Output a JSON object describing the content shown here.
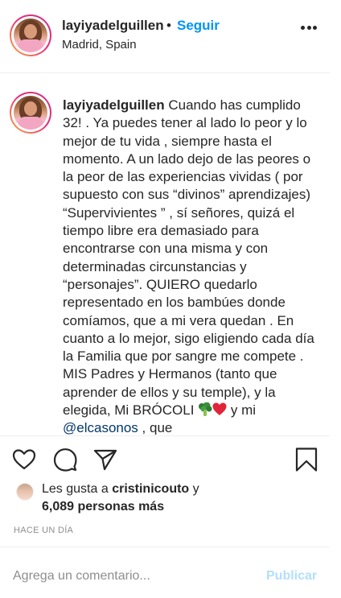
{
  "post_header": {
    "username": "layiyadelguillen",
    "separator": "•",
    "follow_label": "Seguir",
    "location": "Madrid, Spain",
    "more_icon": "more-horizontal-icon"
  },
  "caption": {
    "username": "layiyadelguillen",
    "text_before_mention": "Cuando has cumplido 32! . Ya puedes tener al lado lo peor y lo mejor de tu vida , siempre hasta el momento. A un lado dejo de las peores o la peor de las experiencias vividas ( por supuesto con sus “divinos” aprendizajes) “Supervivientes ” , sí señores, quizá el tiempo libre era demasiado para encontrarse con una misma y con determinadas circunstancias y “personajes”. QUIERO quedarlo representado en los bambúes donde comíamos, que a mi vera quedan . En cuanto a lo mejor, sigo eligiendo cada día la Familia que por sangre me compete . MIS Padres y Hermanos (tanto que aprender de ellos y su temple), y la elegida, Mi BRÓCOLI",
    "text_middle": "y mi",
    "mention": "@elcasonos",
    "text_after_mention": ", que",
    "emojis": [
      "broccoli-emoji",
      "heart-emoji"
    ]
  },
  "actions": {
    "like_icon": "heart-icon",
    "comment_icon": "comment-icon",
    "share_icon": "send-icon",
    "save_icon": "bookmark-icon"
  },
  "likes": {
    "prefix": "Les gusta a",
    "first_liker": "cristinicouto",
    "conjunction": "y",
    "others": "6,089 personas más"
  },
  "timestamp": "HACE UN DÍA",
  "comment_box": {
    "placeholder": "Agrega un comentario...",
    "publish_label": "Publicar"
  },
  "colors": {
    "link_blue": "#0095f6",
    "mention_blue": "#00376b",
    "publish_disabled": "#b2dffc",
    "muted": "#8e8e8e"
  }
}
